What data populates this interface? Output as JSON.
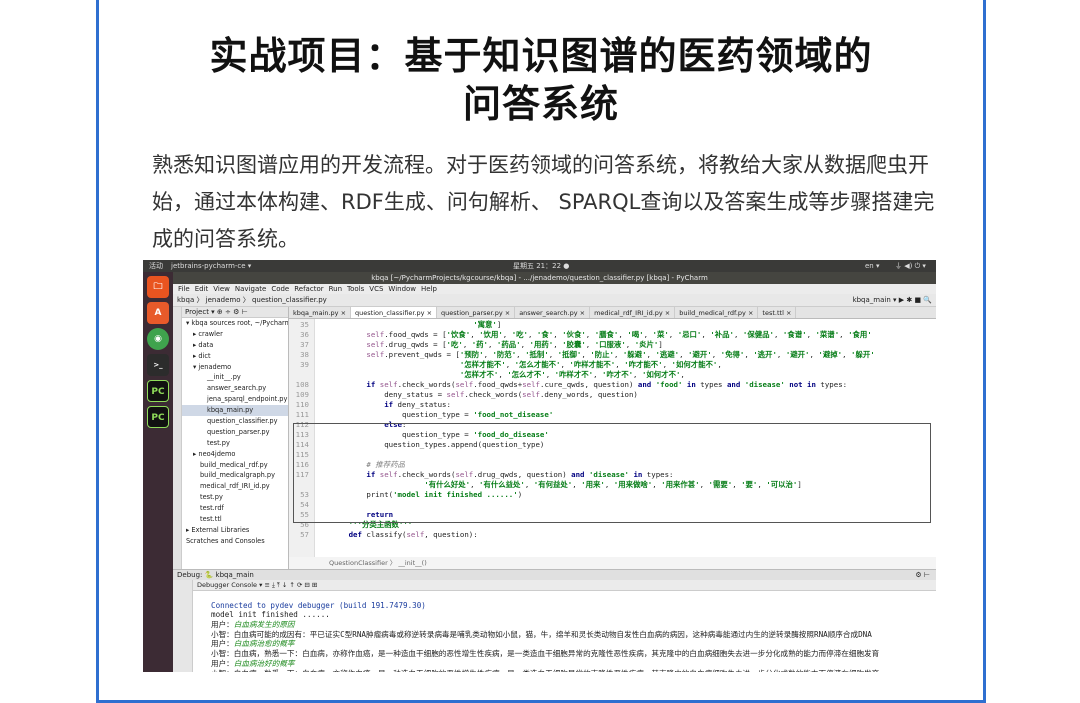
{
  "title": {
    "line1": "实战项目：基于知识图谱的医药领域的",
    "line2": "问答系统"
  },
  "description": "熟悉知识图谱应用的开发流程。对于医药领域的问答系统，将教给大家从数据爬虫开始，通过本体构建、RDF生成、问句解析、 SPARQL查询以及答案生成等步骤搭建完成的问答系统。",
  "screenshot": {
    "topbar": {
      "activities": "活动",
      "app": "jetbrains-pycharm-ce ▾",
      "clock": "星期五 21：22 ●",
      "lang": "en ▾"
    },
    "window_title": "kbqa [~/PycharmProjects/kgcourse/kbqa] - .../jenademo/question_classifier.py [kbqa] - PyCharm",
    "launcher": [
      "A",
      "◉",
      ">_",
      "PC",
      "PC"
    ],
    "menu": [
      "File",
      "Edit",
      "View",
      "Navigate",
      "Code",
      "Refactor",
      "Run",
      "Tools",
      "VCS",
      "Window",
      "Help"
    ],
    "nav": {
      "path": "kbqa 〉 jenademo 〉 question_classifier.py",
      "run_config": "kbqa_main ▾  ▶  ✱  ■  🔍"
    },
    "project_header": "Project ▾      ⊕  ÷  ⚙  ⊢",
    "tree": [
      {
        "label": "▾ kbqa sources root, ~/Pycharm",
        "indent": 0
      },
      {
        "label": "▸ crawler",
        "indent": 1
      },
      {
        "label": "▸ data",
        "indent": 1
      },
      {
        "label": "▸ dict",
        "indent": 1
      },
      {
        "label": "▾ jenademo",
        "indent": 1
      },
      {
        "label": "__init__.py",
        "indent": 3
      },
      {
        "label": "answer_search.py",
        "indent": 3
      },
      {
        "label": "jena_sparql_endpoint.py",
        "indent": 3
      },
      {
        "label": "kbqa_main.py",
        "indent": 3,
        "selected": true
      },
      {
        "label": "question_classifier.py",
        "indent": 3
      },
      {
        "label": "question_parser.py",
        "indent": 3
      },
      {
        "label": "test.py",
        "indent": 3
      },
      {
        "label": "▸ neo4jdemo",
        "indent": 1
      },
      {
        "label": "build_medical_rdf.py",
        "indent": 2
      },
      {
        "label": "build_medicalgraph.py",
        "indent": 2
      },
      {
        "label": "medical_rdf_IRI_id.py",
        "indent": 2
      },
      {
        "label": "test.py",
        "indent": 2
      },
      {
        "label": "test.rdf",
        "indent": 2
      },
      {
        "label": "test.ttl",
        "indent": 2
      },
      {
        "label": "▸ External Libraries",
        "indent": 0
      },
      {
        "label": "Scratches and Consoles",
        "indent": 0
      }
    ],
    "tabs": [
      "kbqa_main.py ×",
      "question_classifier.py ×",
      "question_parser.py ×",
      "answer_search.py ×",
      "medical_rdf_IRI_id.py ×",
      "build_medical_rdf.py ×",
      "test.ttl ×"
    ],
    "code_lines": [
      {
        "n": "35",
        "html": "                                    <span class='st'>'寓意'</span>]"
      },
      {
        "n": "36",
        "html": "            <span class='sf'>self</span>.food_qwds = [<span class='st'>'饮食'</span>, <span class='st'>'饮用'</span>, <span class='st'>'吃'</span>, <span class='st'>'食'</span>, <span class='st'>'伙食'</span>, <span class='st'>'膳食'</span>, <span class='st'>'喝'</span>, <span class='st'>'菜'</span>, <span class='st'>'忌口'</span>, <span class='st'>'补品'</span>, <span class='st'>'保健品'</span>, <span class='st'>'食谱'</span>, <span class='st'>'菜谱'</span>, <span class='st'>'食用'</span>"
      },
      {
        "n": "37",
        "html": "            <span class='sf'>self</span>.drug_qwds = [<span class='st'>'吃'</span>, <span class='st'>'药'</span>, <span class='st'>'药品'</span>, <span class='st'>'用药'</span>, <span class='st'>'胶囊'</span>, <span class='st'>'口服液'</span>, <span class='st'>'炎片'</span>]"
      },
      {
        "n": "38",
        "html": "            <span class='sf'>self</span>.prevent_qwds = [<span class='st'>'预防'</span>, <span class='st'>'防范'</span>, <span class='st'>'抵制'</span>, <span class='st'>'抵御'</span>, <span class='st'>'防止'</span>, <span class='st'>'躲避'</span>, <span class='st'>'逃避'</span>, <span class='st'>'避开'</span>, <span class='st'>'免得'</span>, <span class='st'>'逃开'</span>, <span class='st'>'避开'</span>, <span class='st'>'避掉'</span>, <span class='st'>'躲开'</span>"
      },
      {
        "n": "39",
        "html": "                                 <span class='st'>'怎样才能不'</span>, <span class='st'>'怎么才能不'</span>, <span class='st'>'咋样才能不'</span>, <span class='st'>'咋才能不'</span>, <span class='st'>'如何才能不'</span>,"
      },
      {
        "n": "",
        "html": "                                 <span class='st'>'怎样才不'</span>, <span class='st'>'怎么才不'</span>, <span class='st'>'咋样才不'</span>, <span class='st'>'咋才不'</span>, <span class='st'>'如何才不'</span>,"
      },
      {
        "n": "108",
        "html": "            <span class='kw'>if</span> <span class='sf'>self</span>.check_words(<span class='sf'>self</span>.food_qwds+<span class='sf'>self</span>.cure_qwds, question) <span class='kw'>and</span> <span class='st'>'food'</span> <span class='kw'>in</span> types <span class='kw'>and</span> <span class='st'>'disease'</span> <span class='kw'>not in</span> types:"
      },
      {
        "n": "109",
        "html": "                deny_status = <span class='sf'>self</span>.check_words(<span class='sf'>self</span>.deny_words, question)"
      },
      {
        "n": "110",
        "html": "                <span class='kw'>if</span> deny_status:"
      },
      {
        "n": "111",
        "html": "                    question_type = <span class='st'>'food_not_disease'</span>"
      },
      {
        "n": "112",
        "html": "                <span class='kw'>else</span>:"
      },
      {
        "n": "113",
        "html": "                    question_type = <span class='st'>'food_do_disease'</span>"
      },
      {
        "n": "114",
        "html": "                question_types.append(question_type)"
      },
      {
        "n": "115",
        "html": ""
      },
      {
        "n": "116",
        "html": "            <span class='cm'># 推荐药品</span>"
      },
      {
        "n": "117",
        "html": "            <span class='kw'>if</span> <span class='sf'>self</span>.check_words(<span class='sf'>self</span>.drug_qwds, question) <span class='kw'>and</span> <span class='st'>'disease'</span> <span class='kw'>in</span> types:"
      },
      {
        "n": "",
        "html": "                         <span class='st'>'有什么好处'</span>, <span class='st'>'有什么益处'</span>, <span class='st'>'有何益处'</span>, <span class='st'>'用来'</span>, <span class='st'>'用来做啥'</span>, <span class='st'>'用来作甚'</span>, <span class='st'>'需要'</span>, <span class='st'>'要'</span>, <span class='st'>'可以治'</span>]"
      },
      {
        "n": "53",
        "html": "            print(<span class='st'>'model init finished ......'</span>)"
      },
      {
        "n": "54",
        "html": ""
      },
      {
        "n": "55",
        "html": "            <span class='kw'>return</span>"
      },
      {
        "n": "56",
        "html": "        <span class='st'>'''分类主函数'''</span>"
      },
      {
        "n": "57",
        "html": "        <span class='kw'>def</span> classify(<span class='sf'>self</span>, question):"
      }
    ],
    "breadcrumb": "QuestionClassifier  〉  __init__()",
    "debug_title": "Debug:  🐍 kbqa_main",
    "debug_tabs": "Debugger   Console ▾   ≡  ⤓  ⤒  ↓  ↑  ⟳  ⊟  ⊞",
    "console_lines": [
      {
        "text": "",
        "cls": ""
      },
      {
        "text": "Connected to pydev debugger (build 191.7479.30)",
        "cls": "blue"
      },
      {
        "text": "model init finished ......",
        "cls": ""
      },
      {
        "text": "用户：白血病发生的原因",
        "cls": "green-q"
      },
      {
        "text": "小智：白血病可能的成因有：平已证实C型RNA肿瘤病毒或称逆转录病毒是哺乳类动物如小鼠，猫，牛，绵羊和灵长类动物自发性白血病的病因，这种病毒能通过内生的逆转录酶按照RNA顺序合成DNA",
        "cls": ""
      },
      {
        "text": "用户：白血病治愈的概率",
        "cls": "green-q"
      },
      {
        "text": "小智：白血病，熟悉一下：白血病，亦称作血癌，是一种造血干细胞的恶性增生性疾病，是一类造血干细胞异常的克隆性恶性疾病，其克隆中的白血病细胞失去进一步分化成熟的能力而停滞在细胞发育",
        "cls": ""
      },
      {
        "text": "用户：白血病治好的概率",
        "cls": "green-q"
      },
      {
        "text": "小智：白血病，熟悉一下：白血病，亦称作血癌，是一种造血干细胞的恶性增生性疾病，是一类造血干细胞异常的克隆性恶性疾病，其克隆中的白血病细胞失去进一步分化成熟的能力而停滞在细胞发育",
        "cls": ""
      }
    ]
  }
}
